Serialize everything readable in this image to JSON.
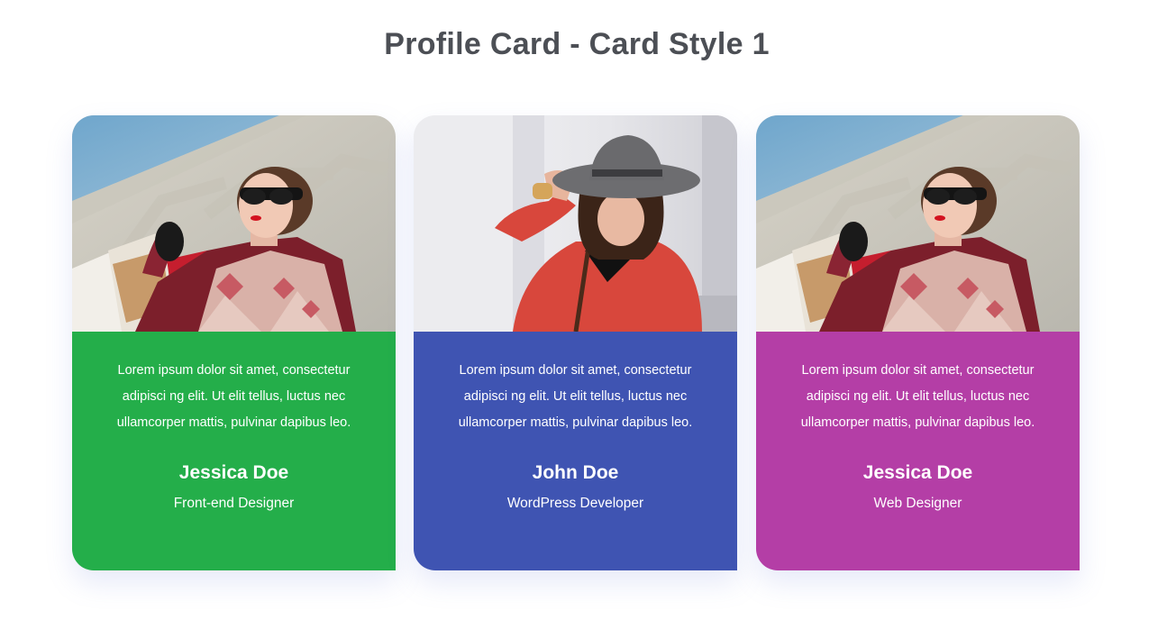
{
  "page": {
    "title": "Profile Card - Card Style 1"
  },
  "cards": [
    {
      "photo_icon": "woman-sunglasses-shopping-photo",
      "text": "Lorem ipsum dolor sit amet, consectetur adipisci ng elit. Ut elit tellus, luctus nec ullamcorper mattis, pulvinar dapibus leo.",
      "name": "Jessica Doe",
      "role": "Front-end Designer",
      "color": "#24ae4a"
    },
    {
      "photo_icon": "woman-grey-hat-photo",
      "text": "Lorem ipsum dolor sit amet, consectetur adipisci ng elit. Ut elit tellus, luctus nec ullamcorper mattis, pulvinar dapibus leo.",
      "name": "John Doe",
      "role": "WordPress Developer",
      "color": "#3f54b2"
    },
    {
      "photo_icon": "woman-sunglasses-shopping-photo",
      "text": "Lorem ipsum dolor sit amet, consectetur adipisci ng elit. Ut elit tellus, luctus nec ullamcorper mattis, pulvinar dapibus leo.",
      "name": "Jessica Doe",
      "role": "Web Designer",
      "color": "#b43ea6"
    }
  ]
}
